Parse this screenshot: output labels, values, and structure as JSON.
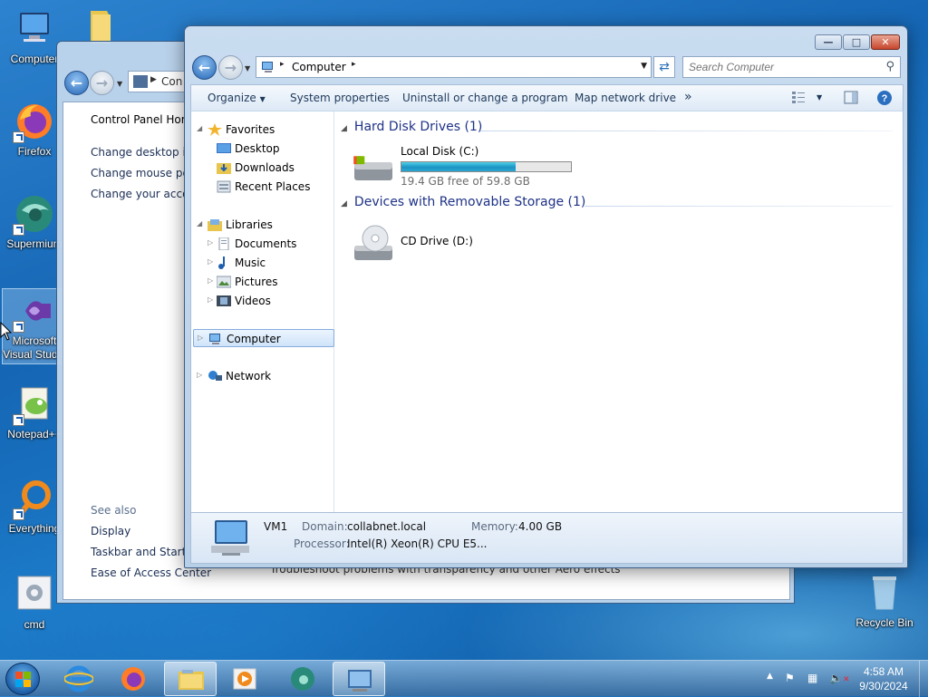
{
  "desktop": {
    "icons": [
      {
        "label": "Computer",
        "icon": "computer-icon"
      },
      {
        "label": "Firefox",
        "icon": "firefox-icon"
      },
      {
        "label": "Supermium",
        "icon": "supermium-icon"
      },
      {
        "label": "Microsoft Visual Studio",
        "icon": "visual-studio-icon"
      },
      {
        "label": "Notepad++",
        "icon": "notepad-plus-plus-icon"
      },
      {
        "label": "Everything",
        "icon": "everything-icon"
      },
      {
        "label": "cmd",
        "icon": "cmd-icon"
      }
    ],
    "recycle_bin": "Recycle Bin"
  },
  "control_panel": {
    "address": "Con",
    "links": [
      "Control Panel Home",
      "Change desktop icons",
      "Change mouse pointers",
      "Change your account picture"
    ],
    "see_also": "See also",
    "see_also_links": [
      "Display",
      "Taskbar and Start Menu",
      "Ease of Access Center"
    ],
    "troubleshoot": "Troubleshoot problems with transparency and other Aero effects"
  },
  "explorer": {
    "address": {
      "separator": "▸",
      "location": "Computer"
    },
    "search": {
      "placeholder": "Search Computer"
    },
    "toolbar": {
      "organize": "Organize",
      "system_properties": "System properties",
      "uninstall": "Uninstall or change a program",
      "map_drive": "Map network drive",
      "more": "»"
    },
    "nav": {
      "favorites": "Favorites",
      "desktop": "Desktop",
      "downloads": "Downloads",
      "recent": "Recent Places",
      "libraries": "Libraries",
      "documents": "Documents",
      "music": "Music",
      "pictures": "Pictures",
      "videos": "Videos",
      "computer": "Computer",
      "network": "Network"
    },
    "groups": {
      "hdd_title": "Hard Disk Drives (1)",
      "removable_title": "Devices with Removable Storage (1)"
    },
    "drives": {
      "c_name": "Local Disk (C:)",
      "c_free": "19.4 GB free of 59.8 GB",
      "c_used_fraction": 0.676,
      "d_name": "CD Drive (D:)"
    },
    "details": {
      "name": "VM1",
      "domain_label": "Domain:",
      "domain": "collabnet.local",
      "memory_label": "Memory:",
      "memory": "4.00 GB",
      "processor_label": "Processor:",
      "processor": "Intel(R) Xeon(R) CPU E5..."
    }
  },
  "taskbar": {
    "time": "4:58 AM",
    "date": "9/30/2024"
  }
}
